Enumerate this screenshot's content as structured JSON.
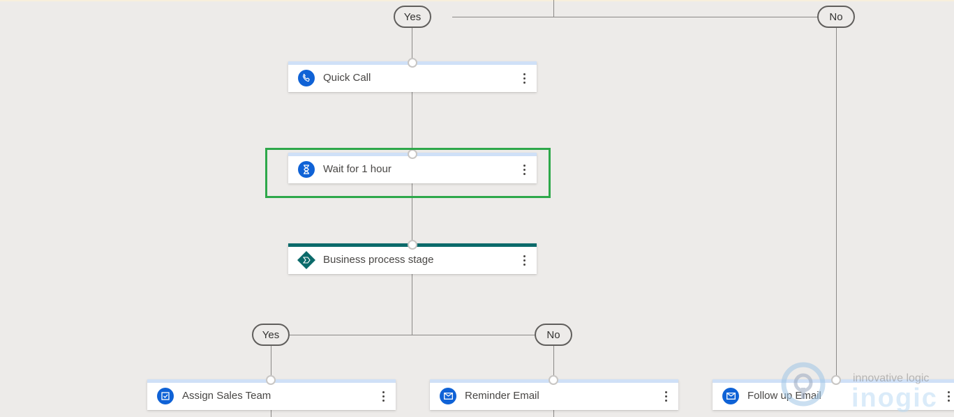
{
  "branches": {
    "top_yes": "Yes",
    "top_no": "No",
    "mid_yes": "Yes",
    "mid_no": "No"
  },
  "steps": {
    "quick_call": {
      "label": "Quick Call",
      "icon": "phone-icon"
    },
    "wait": {
      "label": "Wait for 1 hour",
      "icon": "hourglass-icon"
    },
    "bp_stage": {
      "label": "Business process stage",
      "icon": "business-process-stage-icon"
    },
    "assign_team": {
      "label": "Assign Sales Team",
      "icon": "task-check-icon"
    },
    "reminder_email": {
      "label": "Reminder Email",
      "icon": "email-icon"
    },
    "follow_up_email": {
      "label": "Follow up Email",
      "icon": "email-icon"
    }
  },
  "colors": {
    "highlight": "#2ea84a",
    "accent_blue": "#0f62d6",
    "stage_teal": "#0b6a6a"
  },
  "watermark": {
    "tagline": "innovative logic",
    "brand": "inogic"
  }
}
